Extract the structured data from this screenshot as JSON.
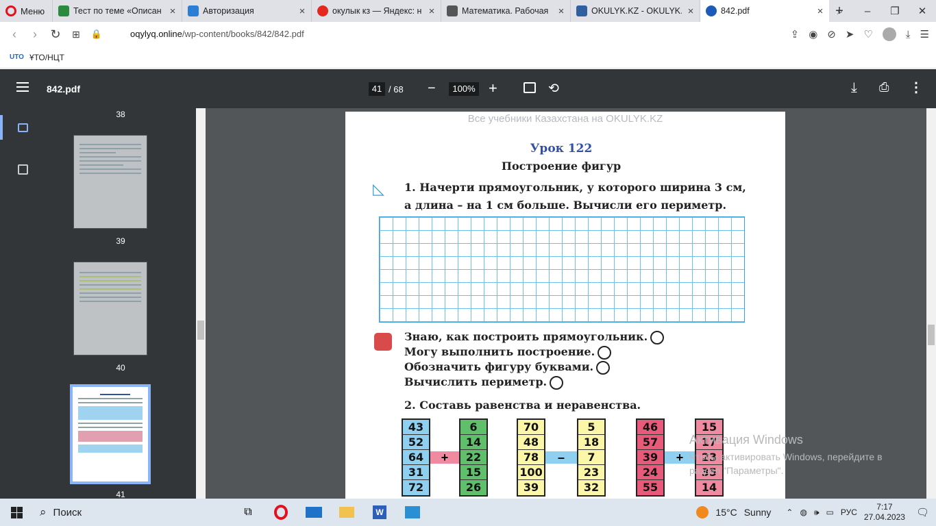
{
  "browser": {
    "menu_label": "Меню",
    "tabs": [
      {
        "title": "Тест по теме «Описан",
        "color": "#2b8a3e"
      },
      {
        "title": "Авторизация",
        "color": "#2a7fd4"
      },
      {
        "title": "окулык кз — Яндекс: н",
        "color": "#e4281e"
      },
      {
        "title": "Математика. Рабочая",
        "color": "#555"
      },
      {
        "title": "OKULYK.KZ - OKULYK.K",
        "color": "#2f5f9f"
      },
      {
        "title": "842.pdf",
        "color": "#1e5ab8"
      }
    ],
    "new_tab": "+",
    "url_domain": "oqylyq.online",
    "url_path": "/wp-content/books/842/842.pdf",
    "bookmark": "ҰТО/НЦТ"
  },
  "pdf": {
    "file_name": "842.pdf",
    "page_current": "41",
    "page_total": "/ 68",
    "zoom": "100%",
    "thumb_numbers": [
      "38",
      "39",
      "40",
      "41"
    ]
  },
  "page": {
    "watermark": "Все учебники Казахстана на OKULYK.KZ",
    "lesson": "Урок 122",
    "title": "Построение фигур",
    "task1_line1": "1. Начерти прямоугольник, у которого ширина 3 см,",
    "task1_line2": "а длина – на 1 см больше. Вычисли его периметр.",
    "self_check": [
      "Знаю, как построить прямоугольник.",
      "Могу выполнить построение.",
      "Обозначить фигуру буквами.",
      "Вычислить периметр."
    ],
    "task2": "2. Составь равенства и неравенства.",
    "groups": [
      {
        "left": [
          "43",
          "52",
          "64",
          "31",
          "72"
        ],
        "right": [
          "6",
          "14",
          "22",
          "15",
          "26"
        ],
        "op": "+",
        "left_color": "#8fd0f0",
        "right_color": "#5fbf6a",
        "bridge_color": "#f08aa0"
      },
      {
        "left": [
          "70",
          "48",
          "78",
          "100",
          "39"
        ],
        "right": [
          "5",
          "18",
          "7",
          "23",
          "32"
        ],
        "op": "–",
        "left_color": "#fbf6a8",
        "right_color": "#fbf6a8",
        "bridge_color": "#8fd0f0"
      },
      {
        "left": [
          "46",
          "57",
          "39",
          "24",
          "55"
        ],
        "right": [
          "15",
          "17",
          "23",
          "35",
          "14"
        ],
        "op": "+",
        "left_color": "#e85a7a",
        "right_color": "#f08aa0",
        "bridge_color": "#8fd0f0"
      }
    ]
  },
  "windows_notice": {
    "title": "Активация Windows",
    "line1": "Чтобы активировать Windows, перейдите в",
    "line2": "раздел \"Параметры\"."
  },
  "taskbar": {
    "search": "Поиск",
    "weather_temp": "15°C",
    "weather_text": "Sunny",
    "lang": "РУС",
    "time": "7:17",
    "date": "27.04.2023"
  }
}
